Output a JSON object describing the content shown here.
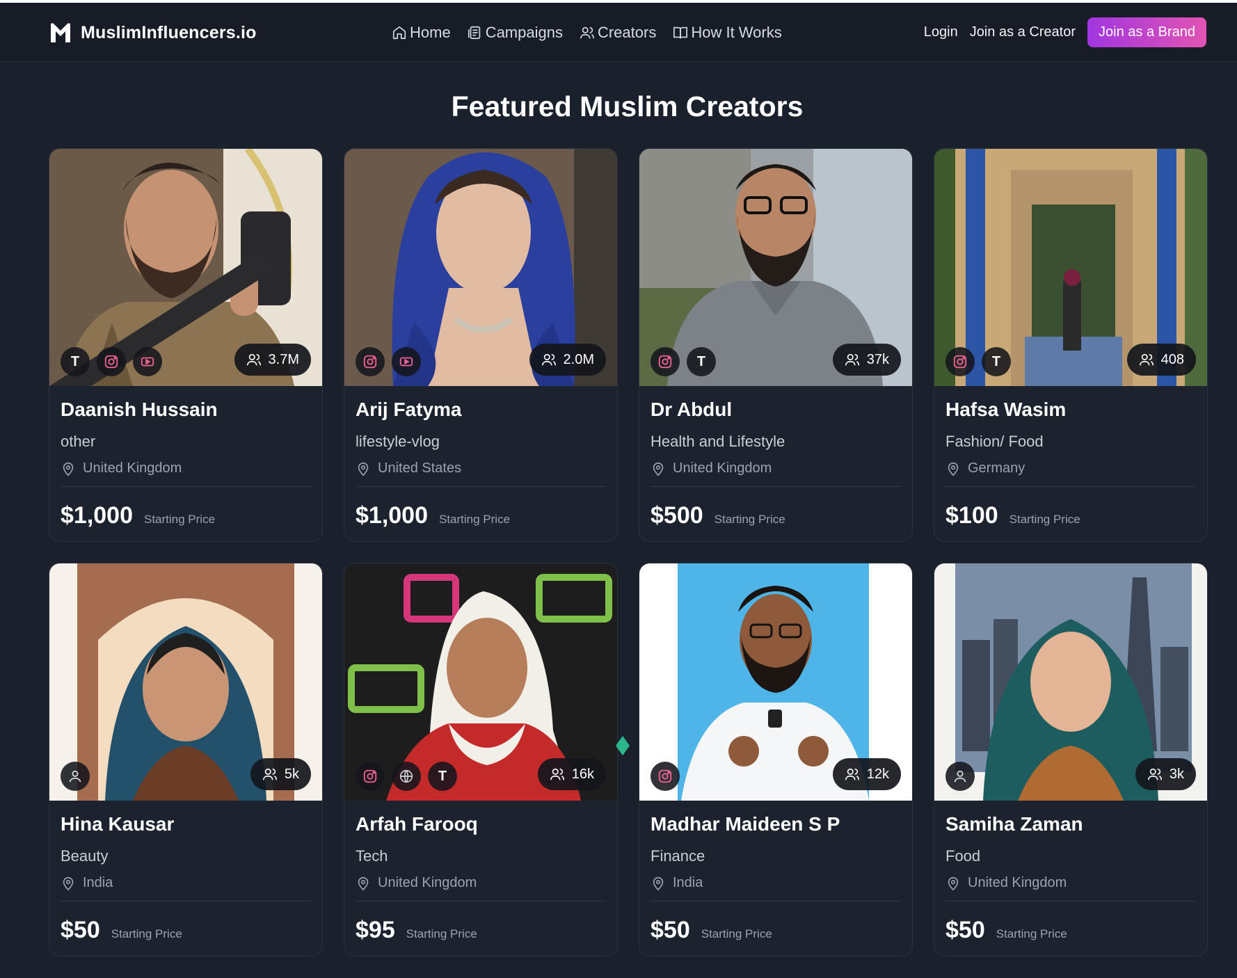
{
  "brand": {
    "name": "MuslimInfluencers.io"
  },
  "nav": {
    "items": [
      {
        "label": "Home",
        "icon": "home-icon"
      },
      {
        "label": "Campaigns",
        "icon": "campaigns-icon"
      },
      {
        "label": "Creators",
        "icon": "users-icon"
      },
      {
        "label": "How It Works",
        "icon": "book-icon"
      }
    ],
    "login": "Login",
    "join_creator": "Join as a Creator",
    "join_brand": "Join as a Brand"
  },
  "colors": {
    "background": "#1b212c",
    "card": "#1d232e",
    "brand_gradient_start": "#a136e0",
    "brand_gradient_end": "#e254b3"
  },
  "section": {
    "title": "Featured Muslim Creators",
    "price_label": "Starting Price"
  },
  "creators": [
    {
      "name": "Daanish Hussain",
      "category": "other",
      "location": "United Kingdom",
      "price": "$1,000",
      "followers": "3.7M",
      "socials": [
        "tiktok",
        "instagram",
        "youtube"
      ]
    },
    {
      "name": "Arij Fatyma",
      "category": "lifestyle-vlog",
      "location": "United States",
      "price": "$1,000",
      "followers": "2.0M",
      "socials": [
        "instagram",
        "youtube"
      ]
    },
    {
      "name": "Dr Abdul",
      "category": "Health and Lifestyle",
      "location": "United Kingdom",
      "price": "$500",
      "followers": "37k",
      "socials": [
        "instagram",
        "tiktok"
      ]
    },
    {
      "name": "Hafsa Wasim",
      "category": "Fashion/ Food",
      "location": "Germany",
      "price": "$100",
      "followers": "408",
      "socials": [
        "instagram",
        "tiktok"
      ]
    },
    {
      "name": "Hina Kausar",
      "category": "Beauty",
      "location": "India",
      "price": "$50",
      "followers": "5k",
      "socials": [
        "profile"
      ]
    },
    {
      "name": "Arfah Farooq",
      "category": "Tech",
      "location": "United Kingdom",
      "price": "$95",
      "followers": "16k",
      "socials": [
        "instagram",
        "website",
        "tiktok"
      ]
    },
    {
      "name": "Madhar Maideen S P",
      "category": "Finance",
      "location": "India",
      "price": "$50",
      "followers": "12k",
      "socials": [
        "instagram"
      ]
    },
    {
      "name": "Samiha Zaman",
      "category": "Food",
      "location": "United Kingdom",
      "price": "$50",
      "followers": "3k",
      "socials": [
        "profile"
      ]
    }
  ]
}
